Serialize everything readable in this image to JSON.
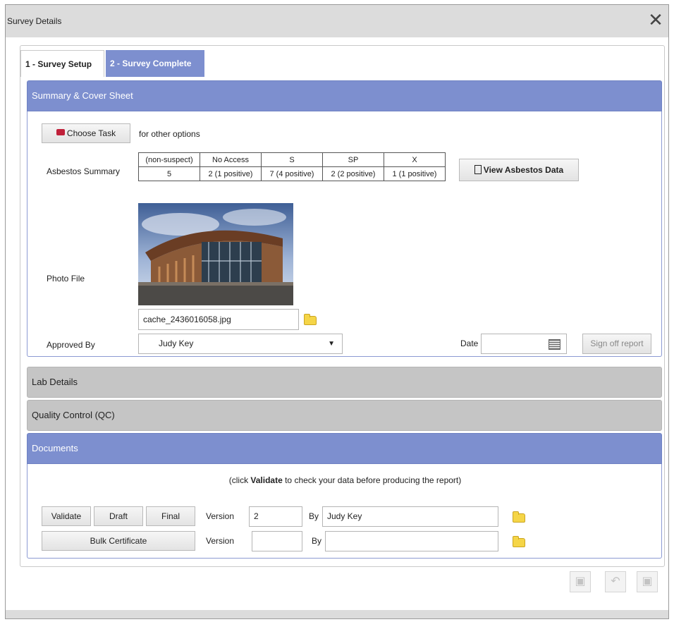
{
  "window": {
    "title": "Survey Details",
    "close_icon": "close-icon"
  },
  "tabs": [
    {
      "label": "1 - Survey Setup",
      "active": true
    },
    {
      "label": "2 - Survey Complete",
      "active": false
    }
  ],
  "summary": {
    "header": "Summary & Cover Sheet",
    "choose_task_label": "Choose Task",
    "choose_task_hint": "for other options",
    "asbestos_label": "Asbestos Summary",
    "asbestos_headers": [
      "(non-suspect)",
      "No Access",
      "S",
      "SP",
      "X"
    ],
    "asbestos_values": [
      "5",
      "2 (1 positive)",
      "7 (4 positive)",
      "2 (2 positive)",
      "1 (1 positive)"
    ],
    "view_asbestos_label": "View Asbestos Data",
    "photo_label": "Photo File",
    "photo_filename": "cache_2436016058.jpg",
    "approved_by_label": "Approved By",
    "approved_by_value": "Judy Key",
    "date_label": "Date",
    "date_value": "",
    "sign_off_label": "Sign off report"
  },
  "lab": {
    "header": "Lab Details"
  },
  "qc": {
    "header": "Quality Control (QC)"
  },
  "documents": {
    "header": "Documents",
    "hint_prefix": "(click ",
    "hint_bold": "Validate",
    "hint_suffix": " to check your data before producing the report)",
    "validate_label": "Validate",
    "draft_label": "Draft",
    "final_label": "Final",
    "version_label": "Version",
    "version_value": "2",
    "by_label": "By",
    "by_value": "Judy Key",
    "bulk_label": "Bulk Certificate",
    "bulk_version_label": "Version",
    "bulk_version_value": "",
    "bulk_by_label": "By",
    "bulk_by_value": ""
  },
  "colors": {
    "accent": "#7d8fcf",
    "panel_gray": "#c5c5c5",
    "titlebar": "#dcdcdc"
  }
}
